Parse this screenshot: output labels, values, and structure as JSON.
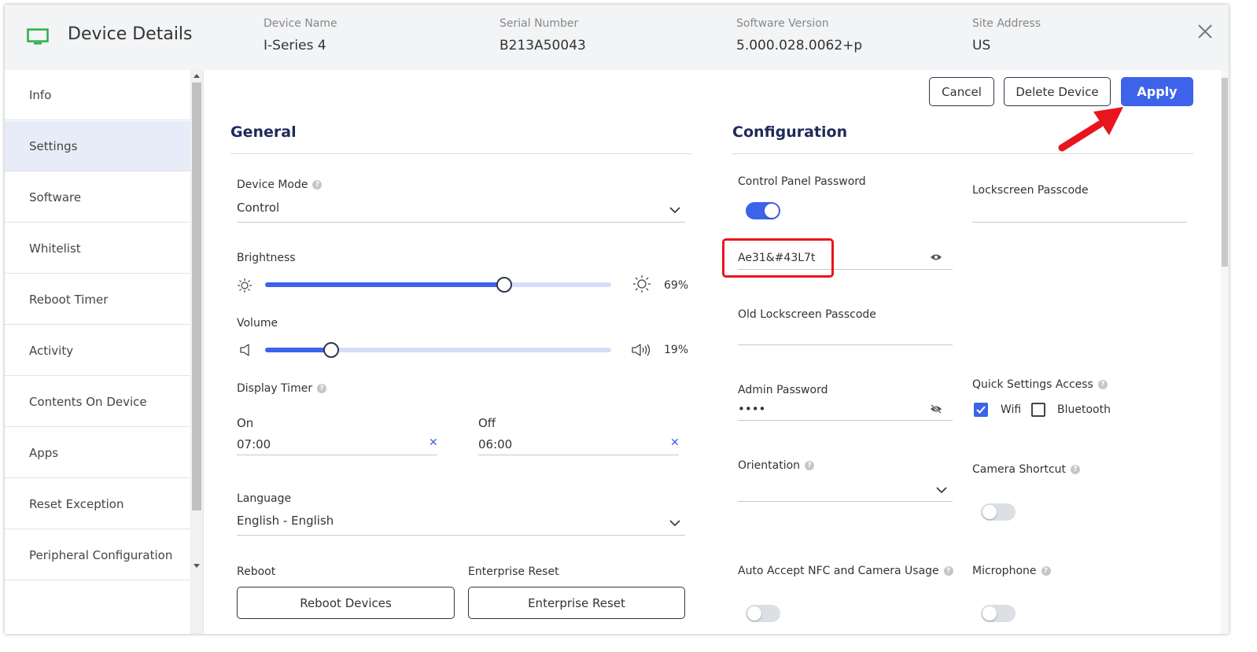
{
  "header": {
    "title": "Device Details",
    "meta": [
      {
        "label": "Device Name",
        "value": "I-Series 4"
      },
      {
        "label": "Serial Number",
        "value": "B213A50043"
      },
      {
        "label": "Software Version",
        "value": "5.000.028.0062+p"
      },
      {
        "label": "Site Address",
        "value": "US"
      }
    ]
  },
  "sidebar": {
    "items": [
      {
        "label": "Info"
      },
      {
        "label": "Settings"
      },
      {
        "label": "Software"
      },
      {
        "label": "Whitelist"
      },
      {
        "label": "Reboot Timer"
      },
      {
        "label": "Activity"
      },
      {
        "label": "Contents On Device"
      },
      {
        "label": "Apps"
      },
      {
        "label": "Reset Exception"
      },
      {
        "label": "Peripheral Configuration"
      }
    ],
    "active": "Settings"
  },
  "actions": {
    "cancel": "Cancel",
    "delete": "Delete Device",
    "apply": "Apply"
  },
  "general": {
    "title": "General",
    "device_mode": {
      "label": "Device Mode",
      "value": "Control"
    },
    "brightness": {
      "label": "Brightness",
      "percent_label": "69%",
      "value": 0.69
    },
    "volume": {
      "label": "Volume",
      "percent_label": "19%",
      "value": 0.19
    },
    "display_timer": {
      "label": "Display Timer",
      "on": {
        "label": "On",
        "value": "07:00"
      },
      "off": {
        "label": "Off",
        "value": "06:00"
      }
    },
    "language": {
      "label": "Language",
      "value": "English - English"
    },
    "reboot": {
      "label": "Reboot",
      "button": "Reboot Devices"
    },
    "enterprise_reset": {
      "label": "Enterprise Reset",
      "button": "Enterprise Reset"
    }
  },
  "configuration": {
    "title": "Configuration",
    "control_panel_password": {
      "label": "Control Panel Password",
      "enabled": true,
      "value": "Ae31&#43L7t"
    },
    "lockscreen_passcode": {
      "label": "Lockscreen Passcode",
      "value": ""
    },
    "old_lockscreen_passcode": {
      "label": "Old Lockscreen Passcode",
      "value": ""
    },
    "admin_password": {
      "label": "Admin Password",
      "value": "••••"
    },
    "quick_settings_access": {
      "label": "Quick Settings Access",
      "wifi": "Wifi",
      "wifi_checked": true,
      "bluetooth": "Bluetooth",
      "bluetooth_checked": false
    },
    "orientation": {
      "label": "Orientation",
      "value": ""
    },
    "camera_shortcut": {
      "label": "Camera Shortcut",
      "enabled": false
    },
    "auto_accept_nfc": {
      "label": "Auto Accept NFC and Camera Usage",
      "enabled": false
    },
    "microphone": {
      "label": "Microphone",
      "enabled": false
    }
  },
  "colors": {
    "accent": "#3d63ea",
    "highlight": "#e8141e",
    "active_bg": "#e7ecf8"
  }
}
